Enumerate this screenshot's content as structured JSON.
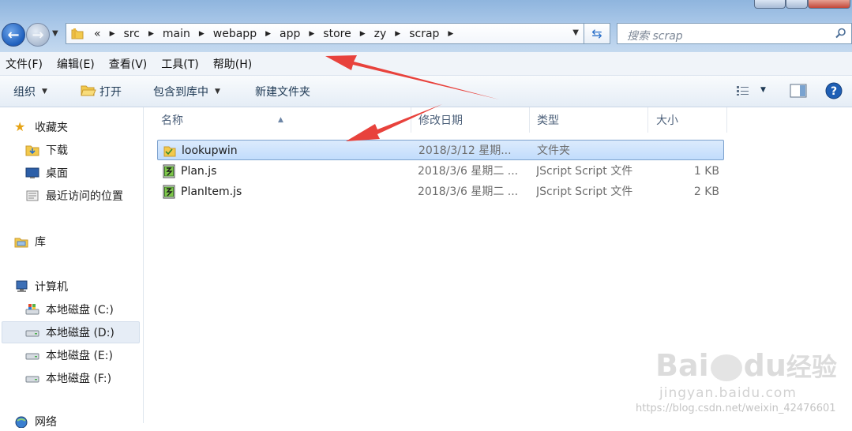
{
  "address_bar": {
    "overflow_glyph": "«",
    "breadcrumbs": [
      "src",
      "main",
      "webapp",
      "app",
      "store",
      "zy",
      "scrap"
    ]
  },
  "search": {
    "placeholder": "搜索 scrap"
  },
  "menu": [
    "文件(F)",
    "编辑(E)",
    "查看(V)",
    "工具(T)",
    "帮助(H)"
  ],
  "toolbar": {
    "organize": "组织",
    "open": "打开",
    "include_in_library": "包含到库中",
    "new_folder": "新建文件夹"
  },
  "sidebar": {
    "favorites": {
      "label": "收藏夹",
      "items": [
        "下载",
        "桌面",
        "最近访问的位置"
      ]
    },
    "libraries": {
      "label": "库"
    },
    "computer": {
      "label": "计算机",
      "drives": [
        "本地磁盘 (C:)",
        "本地磁盘 (D:)",
        "本地磁盘 (E:)",
        "本地磁盘 (F:)"
      ],
      "selected_drive": "本地磁盘 (D:)"
    },
    "network": {
      "label": "网络"
    }
  },
  "columns": {
    "name": "名称",
    "modified": "修改日期",
    "type": "类型",
    "size": "大小"
  },
  "files": [
    {
      "name": "lookupwin",
      "modified": "2018/3/12 星期...",
      "type": "文件夹",
      "size": "",
      "icon": "folder-icon",
      "selected": true
    },
    {
      "name": "Plan.js",
      "modified": "2018/3/6 星期二 ...",
      "type": "JScript Script 文件",
      "size": "1 KB",
      "icon": "jscript-file-icon",
      "selected": false
    },
    {
      "name": "PlanItem.js",
      "modified": "2018/3/6 星期二 ...",
      "type": "JScript Script 文件",
      "size": "2 KB",
      "icon": "jscript-file-icon",
      "selected": false
    }
  ],
  "watermark": {
    "brand": "Bai",
    "brand2": "du",
    "brand_cn": "经验",
    "domain": "jingyan.baidu.com",
    "url": "https://blog.csdn.net/weixin_42476601"
  },
  "colors": {
    "accent": "#2b70c9",
    "selection": "#c1dcfc",
    "arrow": "#e8423c"
  }
}
